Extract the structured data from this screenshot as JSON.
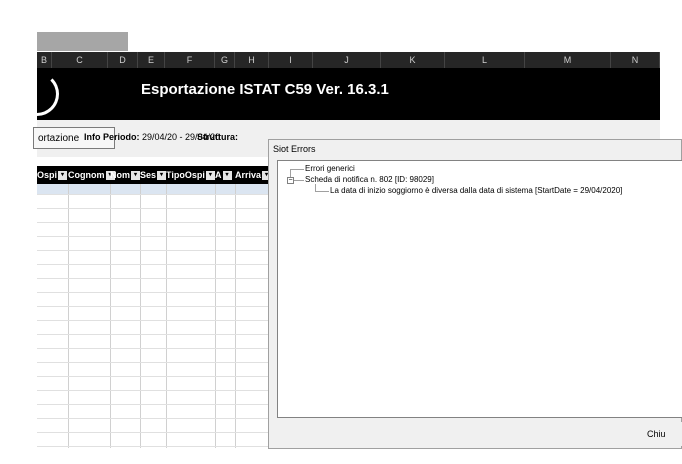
{
  "excel": {
    "columns": [
      "B",
      "C",
      "D",
      "E",
      "F",
      "G",
      "H",
      "I",
      "J",
      "K",
      "L",
      "M",
      "N"
    ],
    "banner_title": "Esportazione ISTAT C59 Ver. 16.3.1",
    "export_button": "ortazione",
    "info_periodo_label": "Info Periodo:",
    "info_periodo_value": "29/04/20 - 29/04/20",
    "struttura_label": "Struttura:",
    "grid_headers": [
      "Ospi",
      "Cognom",
      "Nom",
      "Ses",
      "TipoOspi",
      "A",
      "Arriva"
    ]
  },
  "dialog": {
    "title": "Siot Errors",
    "tree": {
      "item1": "Errori generici",
      "item2": "Scheda di notifica n. 802 [ID: 98029]",
      "item2_child": "La data di inizio soggiorno è diversa dalla data di sistema [StartDate = 29/04/2020]"
    },
    "toggle_symbol": "−",
    "close_button": "Chiu"
  },
  "icons": {
    "dropdown": "▾"
  }
}
